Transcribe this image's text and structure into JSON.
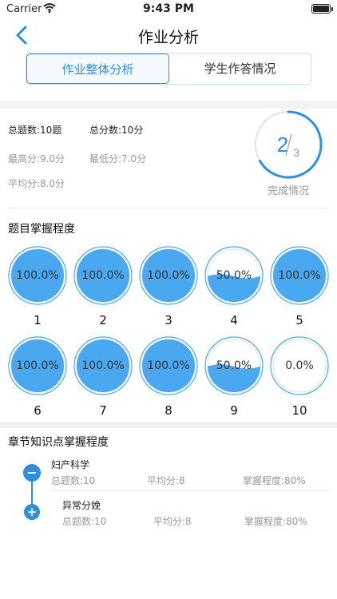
{
  "status_bar": {
    "carrier": "Carrier",
    "time": "9:43 PM"
  },
  "nav": {
    "title": "作业分析",
    "back_icon": "chevron-left-icon"
  },
  "tabs": [
    {
      "label": "作业整体分析",
      "active": true
    },
    {
      "label": "学生作答情况",
      "active": false
    }
  ],
  "summary": {
    "total_questions": "总题数:10题",
    "total_score": "总分数:10分",
    "max_score": "最高分:9.0分",
    "min_score": "最低分:7.0分",
    "avg_score": "平均分:8.0分"
  },
  "completion": {
    "done": "2",
    "total": "3",
    "fraction": 0.667,
    "label": "完成情况"
  },
  "mastery": {
    "title": "题目掌握程度",
    "questions": [
      {
        "num": "1",
        "percent_label": "100.0%",
        "level": 1.0
      },
      {
        "num": "2",
        "percent_label": "100.0%",
        "level": 1.0
      },
      {
        "num": "3",
        "percent_label": "100.0%",
        "level": 1.0
      },
      {
        "num": "4",
        "percent_label": "50.0%",
        "level": 0.5
      },
      {
        "num": "5",
        "percent_label": "100.0%",
        "level": 1.0
      },
      {
        "num": "6",
        "percent_label": "100.0%",
        "level": 1.0
      },
      {
        "num": "7",
        "percent_label": "100.0%",
        "level": 1.0
      },
      {
        "num": "8",
        "percent_label": "100.0%",
        "level": 1.0
      },
      {
        "num": "9",
        "percent_label": "50.0%",
        "level": 0.5
      },
      {
        "num": "10",
        "percent_label": "0.0%",
        "level": 0.0
      }
    ]
  },
  "chapters": {
    "title": "章节知识点掌握程度",
    "items": [
      {
        "name": "妇产科学",
        "expanded": true,
        "count": "总题数:10",
        "avg": "平均分:8",
        "mastery": "掌握程度:80%"
      },
      {
        "name": "异常分娩",
        "expanded": false,
        "count": "总题数:10",
        "avg": "平均分:8",
        "mastery": "掌握程度:80%"
      }
    ]
  },
  "colors": {
    "accent": "#2e8fe0",
    "fill": "#4aa8f0"
  }
}
